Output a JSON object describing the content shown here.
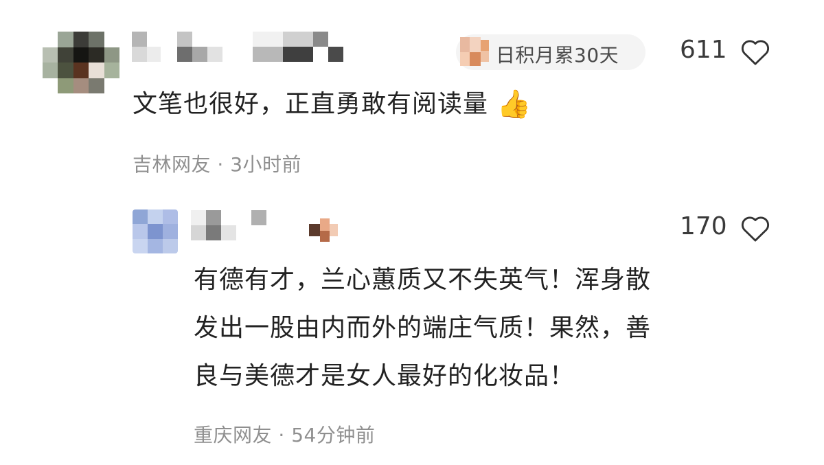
{
  "comments": [
    {
      "badge": "日积月累30天",
      "likes": "611",
      "text": "文笔也很好，正直勇敢有阅读量",
      "emoji": "👍",
      "location": "吉林网友",
      "time": "3小时前"
    },
    {
      "likes": "170",
      "lines": [
        "有德有才，兰心蕙质又不失英气！浑身散",
        "发出一股由内而外的端庄气质！果然，善",
        "良与美德才是女人最好的化妆品！"
      ],
      "location": "重庆网友",
      "time": "54分钟前"
    }
  ],
  "separator": "·",
  "icons": {
    "like": "heart-outline-icon",
    "thumbs": "thumbs-up-emoji-icon"
  }
}
